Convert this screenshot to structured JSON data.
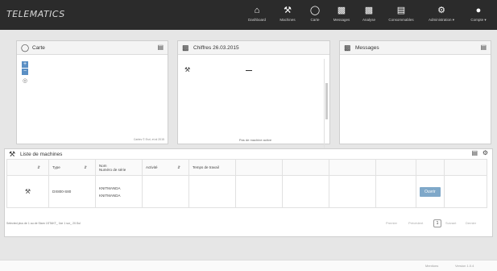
{
  "app": {
    "brand": "TELEMATICS"
  },
  "nav": [
    {
      "label": "Dashboard",
      "icon": "home-icon"
    },
    {
      "label": "Machines",
      "icon": "machine-icon"
    },
    {
      "label": "Carte",
      "icon": "globe-icon"
    },
    {
      "label": "Messages",
      "icon": "messages-icon"
    },
    {
      "label": "Analyse",
      "icon": "chart-icon"
    },
    {
      "label": "Consommables",
      "icon": "consumables-icon"
    },
    {
      "label": "Administration ▾",
      "icon": "admin-icon"
    },
    {
      "label": "Compte ▾",
      "icon": "user-icon"
    }
  ],
  "map_panel": {
    "title": "Carte",
    "footer": "Cartes © Esri, et al 2015"
  },
  "chart_panel": {
    "title": "Chiffres 26.03.2015",
    "empty_text": "Pas de machine active"
  },
  "messages_panel": {
    "title": "Messages"
  },
  "machines_panel": {
    "title": "Liste de machines",
    "columns": [
      "Type",
      "Nom\nNuméro de série",
      "Activité",
      "Temps de travail"
    ],
    "rows": [
      {
        "type": "DX800-S80",
        "name": "KNITMANDA",
        "serial": "KNITMANDA",
        "action": "Ouvrir"
      }
    ],
    "footnote": "Selected plus de 1 au de Starn 1STAKT_ 1ke 1 sur_ 20.Sul",
    "pager": {
      "first": "Premier",
      "prev": "Précédent",
      "current": "1",
      "next": "Suivant",
      "last": "Dernier"
    }
  },
  "footer": {
    "left": "Mentions",
    "right": "Version 1.0.4"
  }
}
